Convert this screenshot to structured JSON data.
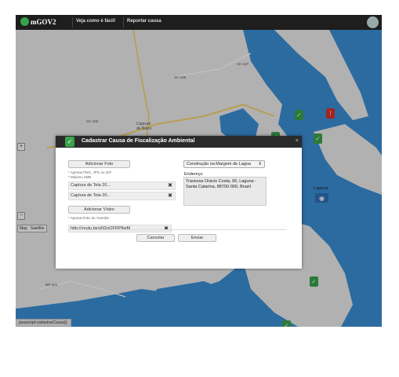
{
  "app": {
    "logo_text": "mGOV2"
  },
  "nav": {
    "items": [
      "Veja como é fácil!",
      "Reportar causa"
    ]
  },
  "map": {
    "zoom_in": "+",
    "zoom_out": "−",
    "type_map": "Map",
    "type_satellite": "Satellite",
    "place_label": "Laguna",
    "town_label": "Capivari de Baixo",
    "road_labels": [
      "SC-437",
      "SC-436",
      "SC-440",
      "BR-101",
      "BR-101"
    ]
  },
  "modal": {
    "title": "Cadastrar Causa de Fiscalização Ambiental",
    "close": "×",
    "add_photo": "Adicionar Foto",
    "photo_hint_1": "* Apenas PNG, JPG ou GIF",
    "photo_hint_2": "* Máximo 4MB",
    "files": [
      "Captura de Tela 20...",
      "Captura de Tela 20..."
    ],
    "delete_icon": "✖",
    "add_video": "Adicionar Vídeo",
    "video_hint": "* Apenas links do Youtube",
    "video_link": "http://youtu.be/sN2oQFRP8wM",
    "category_value": "Construção na Margem de Lagoa",
    "address_label": "Endereço",
    "address_value": "Travessa Orácio Costa, 66, Laguna - Santa Catarina, 88790-000, Brazil",
    "cancel": "Cancelar",
    "submit": "Enviar"
  },
  "statusbar": {
    "text": "javascript:cadastrarCausa();"
  },
  "colors": {
    "sea": "#3a8fd6",
    "land": "#ececec",
    "topbar": "#1e1e1e",
    "pin_green": "#3aa34a",
    "pin_red": "#d9312c"
  }
}
